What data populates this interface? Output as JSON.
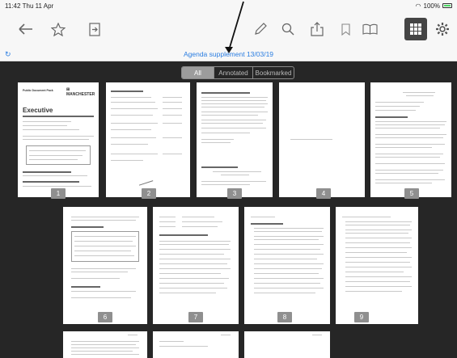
{
  "status": {
    "time": "11:42",
    "day": "Thu 11 Apr",
    "battery": "100%"
  },
  "toolbar": {
    "icons": [
      "back-arrow-icon",
      "star-icon",
      "export-icon",
      "pen-icon",
      "search-icon",
      "share-icon",
      "bookmark-icon",
      "book-icon",
      "grid-icon",
      "gear-icon"
    ]
  },
  "document": {
    "title": "Agenda supplement 13/03/19"
  },
  "filter": {
    "tabs": [
      "All",
      "Annotated",
      "Bookmarked"
    ],
    "selected": "All"
  },
  "pages": [
    {
      "number": "1",
      "heading": "Executive"
    },
    {
      "number": "2",
      "heading": ""
    },
    {
      "number": "3",
      "heading": ""
    },
    {
      "number": "4",
      "heading": ""
    },
    {
      "number": "5",
      "heading": ""
    },
    {
      "number": "6",
      "heading": ""
    },
    {
      "number": "7",
      "heading": ""
    },
    {
      "number": "8",
      "heading": ""
    },
    {
      "number": "9",
      "heading": ""
    }
  ],
  "colors": {
    "accent": "#2a7de1",
    "grid_bg": "#262626",
    "badge": "#8f8f8f"
  }
}
